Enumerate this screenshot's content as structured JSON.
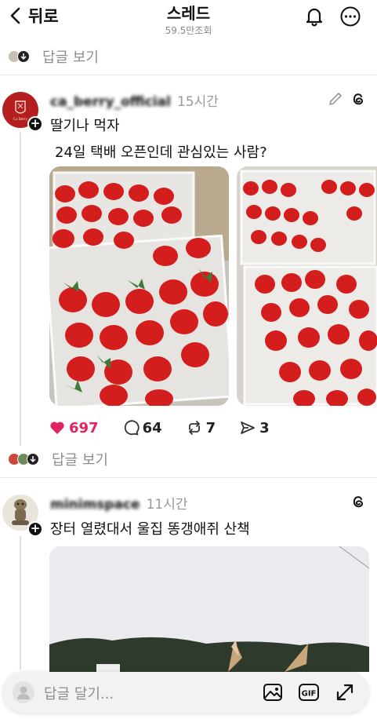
{
  "header": {
    "back_label": "뒤로",
    "title": "스레드",
    "views": "59.5만조회"
  },
  "reply_rows": [
    {
      "label": "답글 보기"
    },
    {
      "label": "답글 보기"
    }
  ],
  "posts": [
    {
      "username": "ca_berry_official",
      "time": "15시간",
      "text_lines": [
        "딸기나 먹자",
        "24일 택배 오픈인데 관심있는 사람?"
      ],
      "stats": {
        "likes": "697",
        "comments": "64",
        "reposts": "7",
        "shares": "3"
      },
      "avatar_logo": "Ca Berry"
    },
    {
      "username": "minimspace",
      "time": "11시간",
      "text_lines": [
        "장터 열렸대서 울집 똥갱애쥐 산책"
      ]
    }
  ],
  "compose": {
    "placeholder": "답글 달기..."
  },
  "colors": {
    "like": "#e0245e",
    "avatar_red": "#b41e1e"
  }
}
